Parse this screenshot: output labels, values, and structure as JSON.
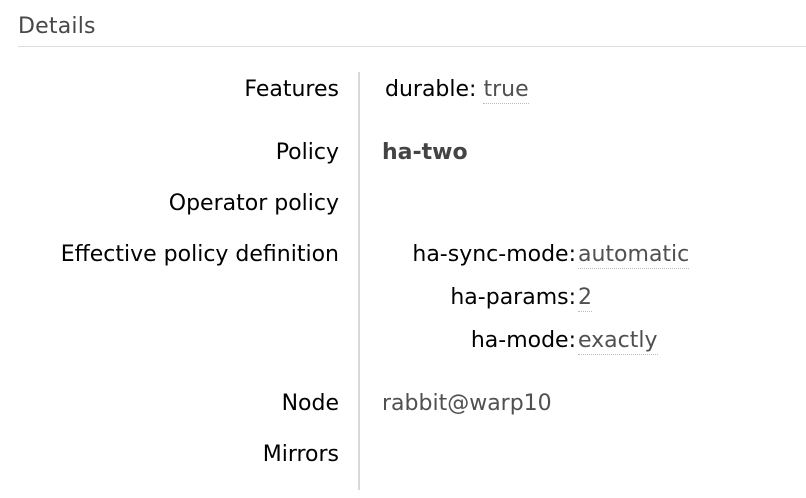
{
  "section": {
    "title": "Details"
  },
  "rows": {
    "features": {
      "label": "Features",
      "key": "durable:",
      "value": "true"
    },
    "policy": {
      "label": "Policy",
      "value": "ha-two"
    },
    "operator_policy": {
      "label": "Operator policy"
    },
    "effective_policy": {
      "label": "Effective policy definition",
      "entries": [
        {
          "key": "ha-sync-mode:",
          "value": "automatic"
        },
        {
          "key": "ha-params:",
          "value": "2"
        },
        {
          "key": "ha-mode:",
          "value": "exactly"
        }
      ]
    },
    "node": {
      "label": "Node",
      "value": "rabbit@warp10"
    },
    "mirrors": {
      "label": "Mirrors"
    }
  }
}
